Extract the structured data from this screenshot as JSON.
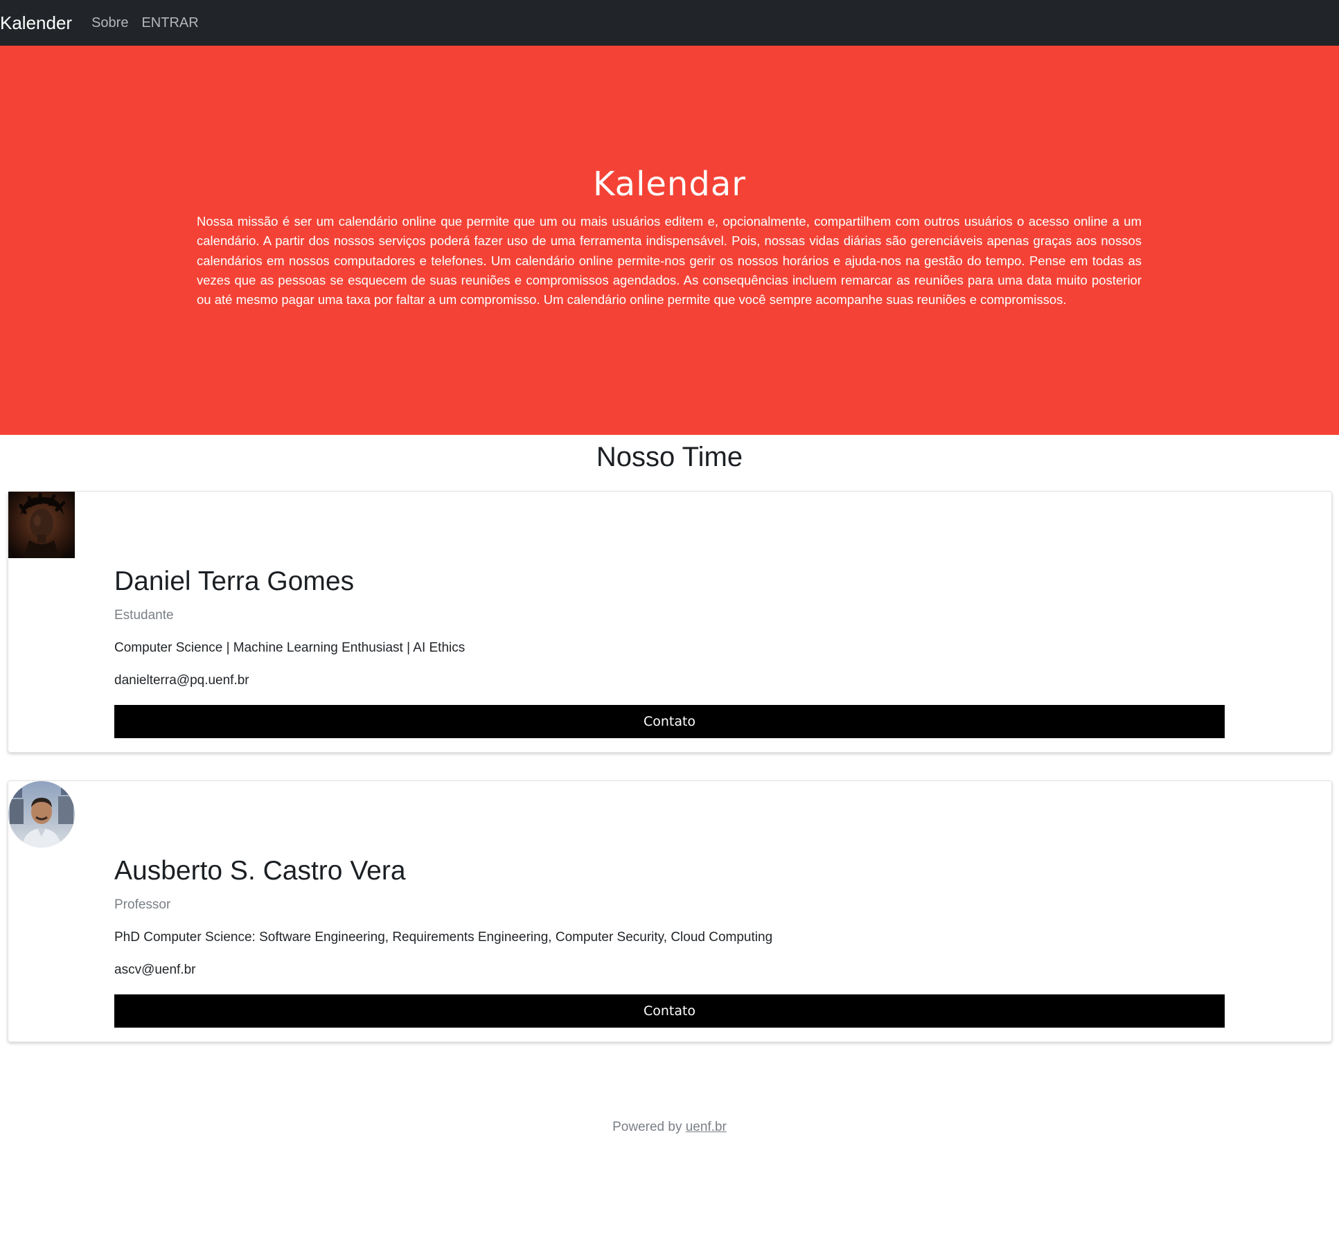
{
  "navbar": {
    "brand": "Kalender",
    "links": [
      "Sobre",
      "ENTRAR"
    ]
  },
  "hero": {
    "title": "Kalendar",
    "text": "Nossa missão é ser um calendário online que permite que um ou mais usuários editem e, opcionalmente, compartilhem com outros usuários o acesso online a um calendário. A partir dos nossos serviços poderá fazer uso de uma ferramenta indispensável. Pois, nossas vidas diárias são gerenciáveis apenas graças aos nossos calendários em nossos computadores e telefones. Um calendário online permite-nos gerir os nossos horários e ajuda-nos na gestão do tempo. Pense em todas as vezes que as pessoas se esquecem de suas reuniões e compromissos agendados. As consequências incluem remarcar as reuniões para uma data muito posterior ou até mesmo pagar uma taxa por faltar a um compromisso. Um calendário online permite que você sempre acompanhe suas reuniões e compromissos.",
    "background_color": "#f44336"
  },
  "team": {
    "title": "Nosso Time",
    "members": [
      {
        "name": "Daniel Terra Gomes",
        "role": "Estudante",
        "bio": "Computer Science | Machine Learning Enthusiast | AI Ethics",
        "email": "danielterra@pq.uenf.br",
        "button_label": "Contato"
      },
      {
        "name": "Ausberto S. Castro Vera",
        "role": "Professor",
        "bio": "PhD Computer Science: Software Engineering, Requirements Engineering, Computer Security, Cloud Computing",
        "email": "ascv@uenf.br",
        "button_label": "Contato"
      }
    ]
  },
  "footer": {
    "prefix": "Powered by",
    "link_text": "uenf.br"
  }
}
